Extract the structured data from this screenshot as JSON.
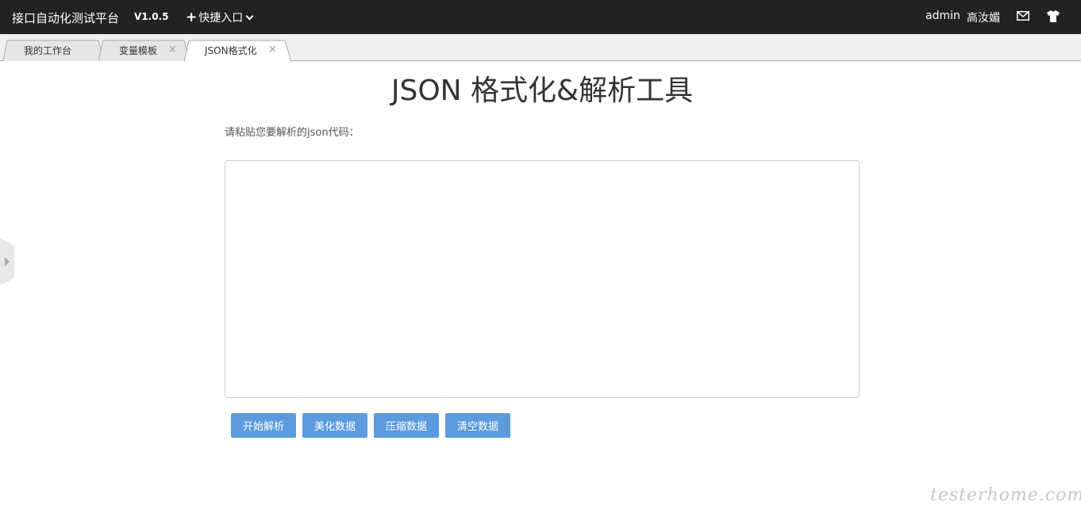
{
  "topbar": {
    "brand": "接口自动化测试平台",
    "version": "V1.0.5",
    "quick_entry": "快捷入口",
    "user": "admin",
    "username": "高汝媚"
  },
  "tabs": [
    {
      "label": "我的工作台",
      "closable": false,
      "active": false
    },
    {
      "label": "变量模板",
      "closable": true,
      "active": false
    },
    {
      "label": "JSON格式化",
      "closable": true,
      "active": true
    }
  ],
  "tab_close_glyph": "×",
  "main": {
    "title": "JSON 格式化&解析工具",
    "prompt": "请粘贴您要解析的json代码：",
    "input_value": ""
  },
  "buttons": {
    "parse": "开始解析",
    "beautify": "美化数据",
    "compress": "压缩数据",
    "clear": "清空数据"
  },
  "watermark": "testerhome.com",
  "colors": {
    "topbar_bg": "#222222",
    "button_bg": "#5b9bde",
    "tabstrip_bg": "#f0f0f0"
  }
}
